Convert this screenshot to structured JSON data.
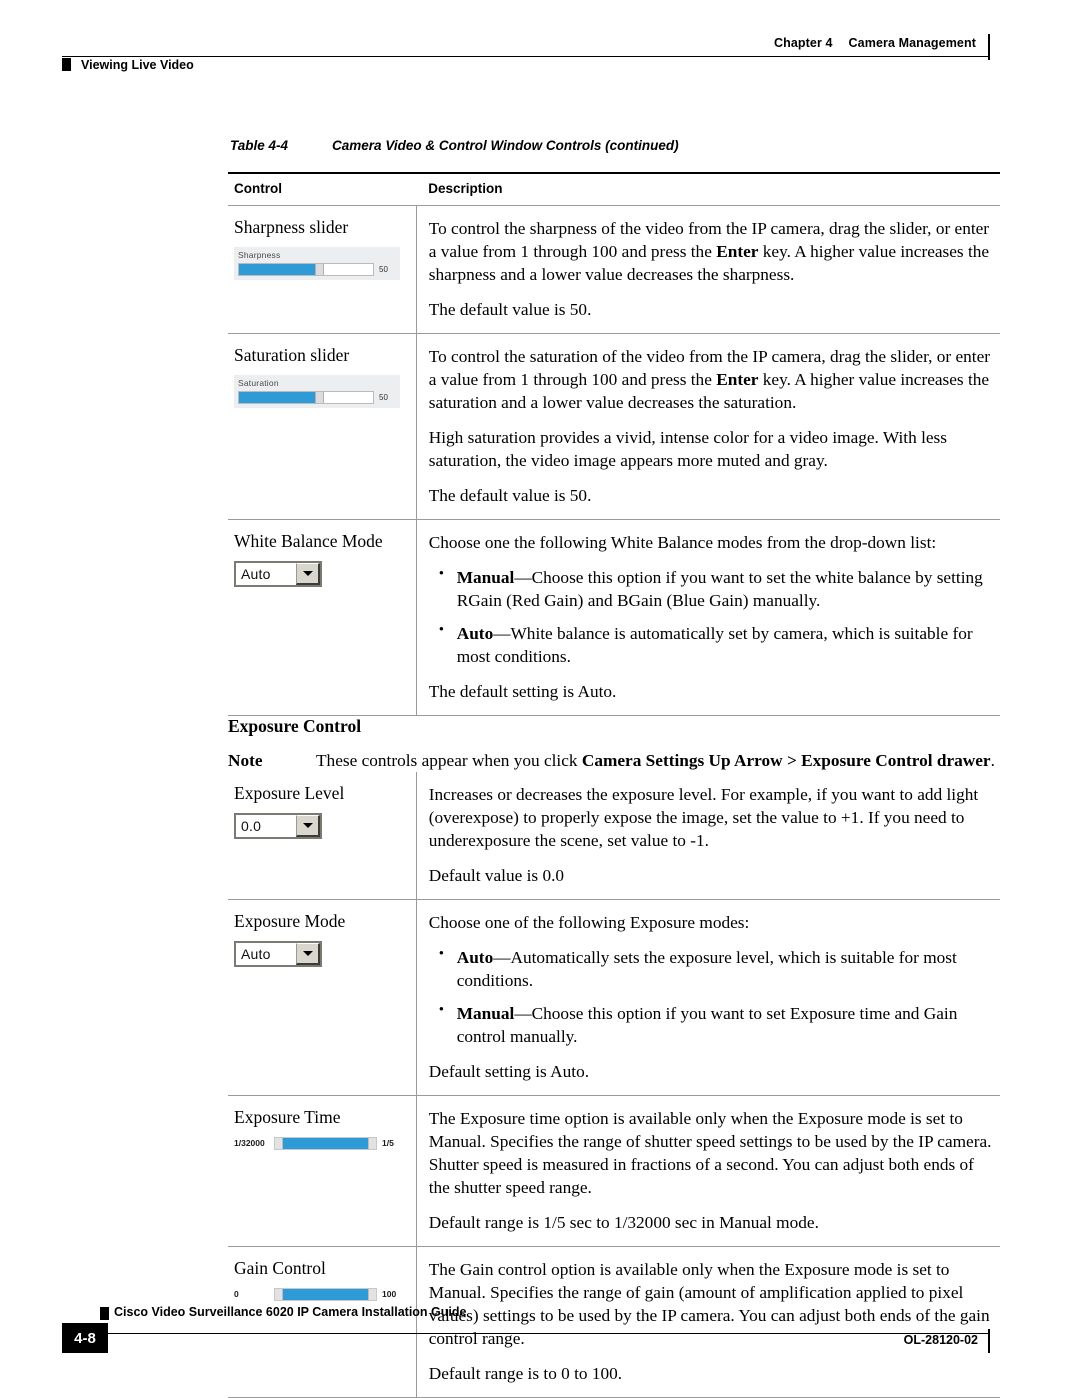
{
  "header": {
    "chapter_number": "Chapter 4",
    "chapter_title": "Camera Management",
    "section_title": "Viewing Live Video"
  },
  "table": {
    "caption_number": "Table 4-4",
    "caption_title": "Camera Video & Control Window Controls (continued)",
    "columns": {
      "control": "Control",
      "description": "Description"
    },
    "rows": [
      {
        "control_label": "Sharpness slider",
        "widget": {
          "type": "slider",
          "panel_label": "Sharpness",
          "value": "50",
          "fill_percent": 57
        },
        "paragraphs": [
          "To control the sharpness of the video from the IP camera, drag the slider, or enter a value from 1 through 100 and press the |Enter| key. A higher value increases the sharpness and a lower value decreases the sharpness.",
          "The default value is 50."
        ],
        "bullets": []
      },
      {
        "control_label": "Saturation slider",
        "widget": {
          "type": "slider",
          "panel_label": "Saturation",
          "value": "50",
          "fill_percent": 57
        },
        "paragraphs": [
          "To control the saturation of the video from the IP camera, drag the slider, or enter a value from 1 through 100 and press the |Enter| key. A higher value increases the saturation and a lower value decreases the saturation.",
          "High saturation provides a vivid, intense color for a video image. With less saturation, the video image appears more muted and gray.",
          "The default value is 50."
        ],
        "bullets": []
      },
      {
        "control_label": "White Balance Mode",
        "widget": {
          "type": "combo",
          "value": "Auto"
        },
        "intro": "Choose one the following White Balance modes from the drop-down list:",
        "bullets": [
          "|Manual|—Choose this option if you want to set the white balance by setting RGain (Red Gain) and BGain (Blue Gain) manually.",
          "|Auto|—White balance is automatically set by camera, which is suitable for most conditions."
        ],
        "paragraphs": [
          "The default setting is Auto."
        ]
      }
    ],
    "band": {
      "title": "Exposure Control",
      "note_label": "Note",
      "note_text": "These controls appear when you click |Camera Settings Up Arrow > Exposure Control drawer|."
    },
    "rows2": [
      {
        "control_label": "Exposure Level",
        "widget": {
          "type": "combo",
          "value": "0.0"
        },
        "paragraphs": [
          "Increases or decreases the exposure level. For example, if you want to add light (overexpose) to properly expose the image, set the value to +1. If you need to underexposure the scene, set value to -1.",
          "Default value is 0.0"
        ],
        "bullets": []
      },
      {
        "control_label": "Exposure Mode",
        "widget": {
          "type": "combo",
          "value": "Auto"
        },
        "intro": "Choose one of the following Exposure modes:",
        "bullets": [
          "|Auto|—Automatically sets the exposure level, which is suitable for most conditions.",
          "|Manual|—Choose this option if you want to set Exposure time and Gain control manually."
        ],
        "paragraphs": [
          "Default setting is Auto."
        ]
      },
      {
        "control_label": "Exposure Time",
        "widget": {
          "type": "range",
          "min_label": "1/32000",
          "max_label": "1/5"
        },
        "paragraphs": [
          "The Exposure time option is available only when the Exposure mode is set to Manual. Specifies the range of shutter speed settings to be used by the IP camera. Shutter speed is measured in fractions of a second. You can adjust both ends of the shutter speed range.",
          "Default range is 1/5 sec to 1/32000 sec in Manual mode."
        ],
        "bullets": []
      },
      {
        "control_label": "Gain Control",
        "widget": {
          "type": "range",
          "min_label": "0",
          "max_label": "100"
        },
        "paragraphs": [
          "The Gain control option is available only when the Exposure mode is set to Manual. Specifies the range of gain (amount of amplification applied to pixel values) settings to be used by the IP camera. You can adjust both ends of the gain control range.",
          "Default range is to 0 to 100."
        ],
        "bullets": []
      }
    ]
  },
  "footer": {
    "page_number": "4-8",
    "guide_title": "Cisco Video Surveillance 6020 IP Camera Installation Guide",
    "doc_id": "OL-28120-02"
  },
  "colors": {
    "slider_fill": "#2e9bd6",
    "rule": "#9a9a9a",
    "panel_bg": "#eceeef"
  }
}
